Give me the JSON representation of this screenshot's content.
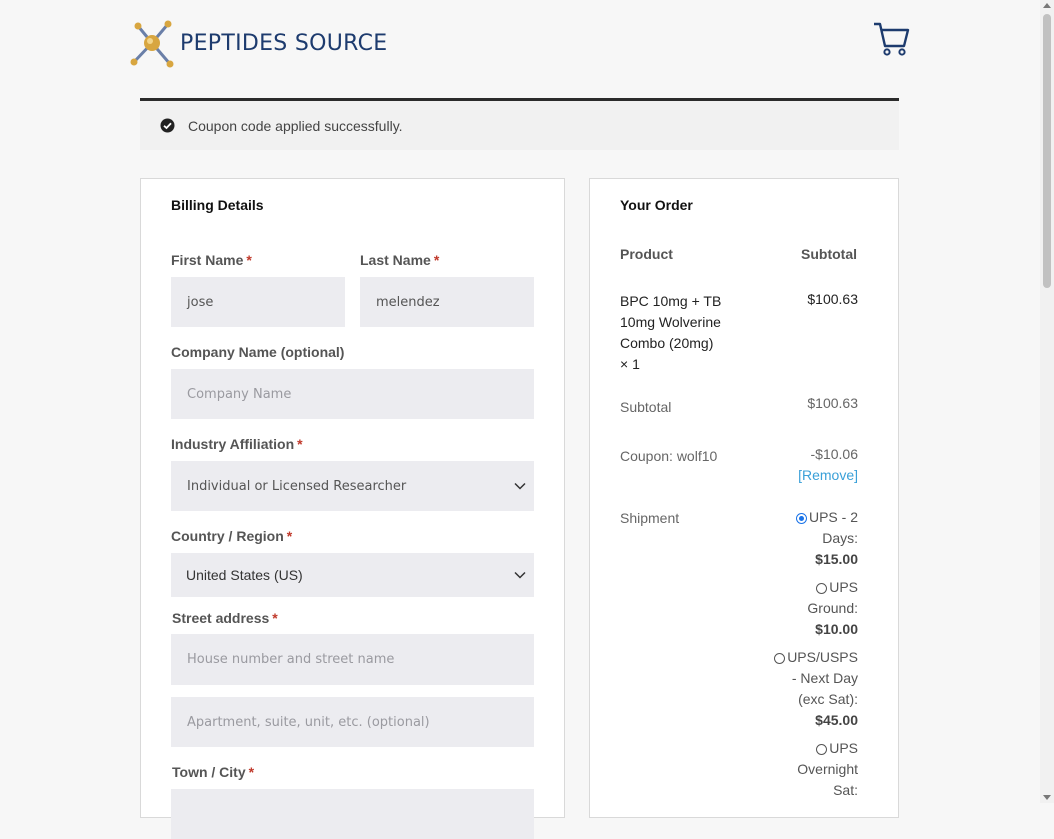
{
  "header": {
    "logo_text": "PEPTIDES SOURCE",
    "cart_icon": "cart-icon"
  },
  "notice": {
    "icon": "check-circle-icon",
    "text": "Coupon code applied successfully."
  },
  "billing": {
    "title": "Billing Details",
    "first_name": {
      "label": "First Name",
      "value": "jose"
    },
    "last_name": {
      "label": "Last Name",
      "value": "melendez"
    },
    "company": {
      "label": "Company Name (optional)",
      "placeholder": "Company Name"
    },
    "industry": {
      "label": "Industry Affiliation",
      "value": "Individual or Licensed Researcher"
    },
    "country": {
      "label": "Country / Region",
      "value": "United States (US)"
    },
    "street": {
      "label": "Street address",
      "placeholder1": "House number and street name",
      "placeholder2": "Apartment, suite, unit, etc. (optional)"
    },
    "city": {
      "label": "Town / City"
    },
    "required_mark": "*"
  },
  "order": {
    "title": "Your Order",
    "col_product": "Product",
    "col_subtotal": "Subtotal",
    "item": {
      "name_l1": "BPC 10mg + TB",
      "name_l2": "10mg Wolverine",
      "name_l3": "Combo (20mg)",
      "qty": "× 1",
      "price": "$100.63"
    },
    "subtotal": {
      "label": "Subtotal",
      "value": "$100.63"
    },
    "coupon": {
      "label": "Coupon: wolf10",
      "value": "-$10.06",
      "remove": "[Remove]"
    },
    "shipment": {
      "label": "Shipment",
      "options": [
        {
          "l1": "UPS - 2",
          "l2": "Days:",
          "price": "$15.00",
          "selected": true
        },
        {
          "l1": "UPS",
          "l2": "Ground:",
          "price": "$10.00",
          "selected": false
        },
        {
          "l1": "UPS/USPS",
          "l2": "- Next Day",
          "l3": "(exc Sat):",
          "price": "$45.00",
          "selected": false
        },
        {
          "l1": "UPS",
          "l2": "Overnight",
          "l3": "Sat:",
          "selected": false
        }
      ]
    }
  },
  "colors": {
    "brand": "#1d3b6e",
    "accent_link": "#3aa0d8",
    "field_bg": "#ececf0",
    "required": "#c0392b"
  }
}
